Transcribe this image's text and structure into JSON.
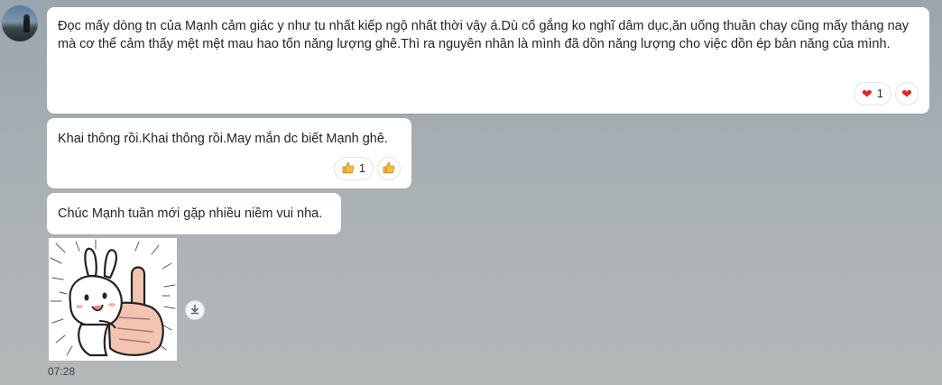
{
  "messages": [
    {
      "text": "Đọc mấy dòng tn của Mạnh cảm giác y như tu nhất kiếp ngộ nhất thời vậy á.Dù cố gắng ko nghĩ dâm dục,ăn uống thuần chay cũng mấy tháng nay mà cơ thể cảm thấy mệt mệt mau hao tốn năng lượng ghê.Thì ra nguyên nhân là mình đã dồn năng lượng cho việc dồn ép bản năng của mình.",
      "reaction_icon": "heart-icon",
      "reaction_count": "1",
      "reaction_add_icon": "heart-icon"
    },
    {
      "text": "Khai thông rồi.Khai thông rồi.May mắn dc biết Mạnh ghê.",
      "reaction_icon": "thumbs-up-icon",
      "reaction_count": "1",
      "reaction_add_icon": "thumbs-up-icon"
    },
    {
      "text": "Chúc Mạnh tuần mới gặp nhiều niềm vui nha."
    }
  ],
  "sticker": {
    "icon": "rabbit-thumbs-up-sticker"
  },
  "download_icon": "download-icon",
  "timestamp": "07:28",
  "colors": {
    "bubble": "#ffffff",
    "heart": "#e0262b",
    "thumb": "#f1b83a",
    "background": "#a9b0b4"
  }
}
